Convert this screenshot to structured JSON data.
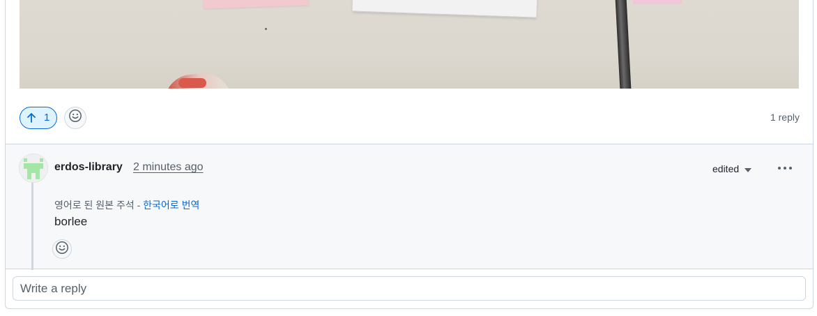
{
  "post": {
    "upvote_count": "1",
    "reply_count": "1 reply"
  },
  "reply": {
    "author": "erdos-library",
    "timestamp": "2 minutes ago",
    "edited_label": "edited",
    "translation_note": "영어로 된 원본 주석 -",
    "translation_link": "한국어로 번역",
    "body": "borlee"
  },
  "composer": {
    "placeholder": "Write a reply"
  },
  "icons": {
    "upvote": "arrow-up-icon",
    "reaction": "smiley-icon",
    "more": "kebab-horizontal-icon",
    "dropdown": "triangle-down-icon"
  },
  "colors": {
    "accent": "#0969da",
    "accent_bg": "#ddf4ff",
    "avatar_identicon": "#a3e6a6",
    "border": "#d0d7de",
    "muted_text": "#57606a"
  }
}
